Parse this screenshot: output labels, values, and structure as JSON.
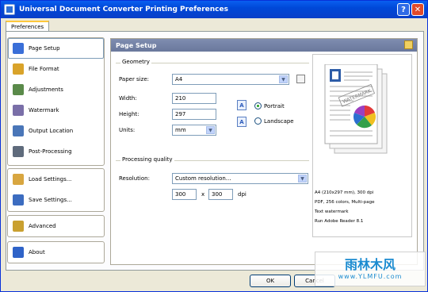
{
  "window": {
    "title": "Universal Document Converter Printing Preferences"
  },
  "titlebar": {
    "help": "?",
    "close": "✕"
  },
  "tabs": [
    {
      "label": "Preferences"
    }
  ],
  "nav": {
    "items": [
      {
        "label": "Page Setup",
        "icon": "page-setup-icon",
        "color": "#3a6fd8"
      },
      {
        "label": "File Format",
        "icon": "file-format-icon",
        "color": "#d9a32a"
      },
      {
        "label": "Adjustments",
        "icon": "adjustments-icon",
        "color": "#5a8a4a"
      },
      {
        "label": "Watermark",
        "icon": "watermark-icon",
        "color": "#7a6fa8"
      },
      {
        "label": "Output Location",
        "icon": "folder-icon",
        "color": "#4a76b8"
      },
      {
        "label": "Post-Processing",
        "icon": "post-processing-icon",
        "color": "#5f6b7c"
      }
    ],
    "settings_items": [
      {
        "label": "Load Settings...",
        "icon": "load-settings-icon",
        "color": "#d8a640"
      },
      {
        "label": "Save Settings...",
        "icon": "save-settings-icon",
        "color": "#3c6cc0"
      }
    ],
    "advanced": {
      "label": "Advanced",
      "icon": "advanced-icon",
      "color": "#c9a030"
    },
    "about": {
      "label": "About",
      "icon": "help-icon",
      "color": "#2f63c8"
    }
  },
  "content": {
    "header": "Page Setup",
    "geometry": {
      "legend": "Geometry",
      "paper_size_label": "Paper size:",
      "paper_size_value": "A4",
      "width_label": "Width:",
      "width_value": "210",
      "height_label": "Height:",
      "height_value": "297",
      "units_label": "Units:",
      "units_value": "mm",
      "portrait_label": "Portrait",
      "landscape_label": "Landscape",
      "orientation_selected": "Portrait"
    },
    "quality": {
      "legend": "Processing quality",
      "resolution_label": "Resolution:",
      "resolution_value": "Custom resolution...",
      "dpi_x": "300",
      "by": "x",
      "dpi_y": "300",
      "dpi_unit": "dpi"
    },
    "preview": {
      "watermark_text": "WATERMARK",
      "info": [
        "A4 (210x297 mm), 300 dpi",
        "PDF, 256 colors, Multi-page",
        "Text watermark",
        "Run Adobe Reader 8.1"
      ]
    }
  },
  "buttons": {
    "ok": "OK",
    "cancel": "Cancel"
  },
  "overlay_watermark": {
    "text": "雨林木风",
    "url": "www.YLMFU.com"
  }
}
